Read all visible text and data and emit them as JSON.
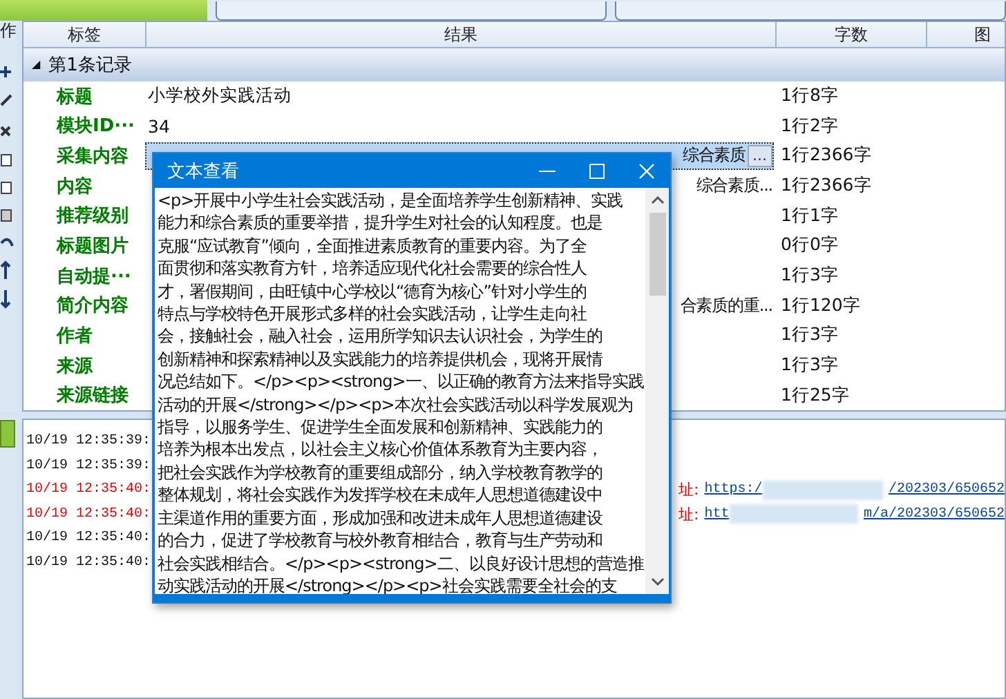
{
  "toolbar": {
    "label": "作"
  },
  "table": {
    "columns": [
      "标签",
      "结果",
      "字数",
      "图"
    ],
    "group": {
      "label": "第1条记录",
      "toggle": "◢"
    },
    "rows": [
      {
        "label": "标题",
        "result": "小学校外实践活动",
        "count": "1行8字",
        "selected": false
      },
      {
        "label": "模块ID···",
        "result": "34",
        "count": "1行2字",
        "selected": false
      },
      {
        "label": "采集内容",
        "tail": "综合素质",
        "count": "1行2366字",
        "selected": true,
        "button": "..."
      },
      {
        "label": "内容",
        "tail": "综合素质...",
        "count": "1行2366字",
        "selected": false
      },
      {
        "label": "推荐级别",
        "count": "1行1字",
        "selected": false
      },
      {
        "label": "标题图片",
        "count": "0行0字",
        "selected": false
      },
      {
        "label": "自动提···",
        "count": "1行3字",
        "selected": false
      },
      {
        "label": "简介内容",
        "tail": "合素质的重...",
        "count": "1行120字",
        "selected": false
      },
      {
        "label": "作者",
        "count": "1行3字",
        "selected": false
      },
      {
        "label": "来源",
        "count": "1行3字",
        "selected": false
      },
      {
        "label": "来源链接",
        "count": "1行25字",
        "selected": false
      }
    ]
  },
  "log": [
    {
      "time": "10/19 12:35:39:",
      "kind": "info"
    },
    {
      "time": "10/19 12:35:39:",
      "kind": "info"
    },
    {
      "time": "10/19 12:35:40:",
      "kind": "error",
      "tail": "址:",
      "link_start": "https:/",
      "link_end": "/202303/650652"
    },
    {
      "time": "10/19 12:35:40:",
      "kind": "error",
      "tail": "址:",
      "link_start": "htt",
      "link_end": "m/a/202303/650652"
    },
    {
      "time": "10/19 12:35:40:",
      "kind": "info"
    },
    {
      "time": "10/19 12:35:40:",
      "kind": "info"
    }
  ],
  "dialog": {
    "title": "文本查看",
    "lines": [
      "<p>开展中小学生社会实践活动，是全面培养学生创新精神、实践",
      "能力和综合素质的重要举措，提升学生对社会的认知程度。也是",
      "克服“应试教育”倾向，全面推进素质教育的重要内容。为了全",
      "面贯彻和落实教育方针，培养适应现代化社会需要的综合性人",
      "才，署假期间，由旺镇中心学校以“德育为核心”针对小学生的",
      "特点与学校特色开展形式多样的社会实践活动，让学生走向社",
      "会，接触社会，融入社会，运用所学知识去认识社会，为学生的",
      "创新精神和探索精神以及实践能力的培养提供机会，现将开展情",
      "况总结如下。</p><p><strong>一、以正确的教育方法来指导实践",
      "活动的开展</strong></p><p>本次社会实践活动以科学发展观为",
      "指导，以服务学生、促进学生全面发展和创新精神、实践能力的",
      "培养为根本出发点，以社会主义核心价值体系教育为主要内容，",
      "把社会实践作为学校教育的重要组成部分，纳入学校教育教学的",
      "整体规划，将社会实践作为发挥学校在未成年人思想道德建设中",
      "主渠道作用的重要方面，形成加强和改进未成年人思想道德建设",
      "的合力，促进了学校教育与校外教育相结合，教育与生产劳动和",
      "社会实践相结合。</p><p><strong>二、以良好设计思想的营造推",
      "动实践活动的开展</strong></p><p>社会实践需要全社会的支"
    ]
  }
}
